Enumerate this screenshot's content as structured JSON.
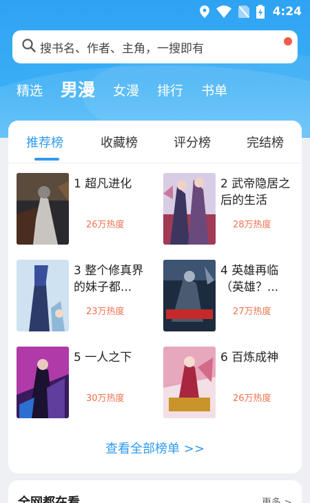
{
  "status_bar": {
    "time": "4:24"
  },
  "search": {
    "placeholder": "搜书名、作者、主角，一搜即有"
  },
  "top_tabs": [
    {
      "label": "精选",
      "active": false
    },
    {
      "label": "男漫",
      "active": true
    },
    {
      "label": "女漫",
      "active": false
    },
    {
      "label": "排行",
      "active": false
    },
    {
      "label": "书单",
      "active": false
    }
  ],
  "rank_tabs": [
    {
      "label": "推荐榜",
      "active": true
    },
    {
      "label": "收藏榜",
      "active": false
    },
    {
      "label": "评分榜",
      "active": false
    },
    {
      "label": "完结榜",
      "active": false
    }
  ],
  "books": [
    {
      "rank": "1",
      "title": "超凡进化",
      "heat": "26万热度"
    },
    {
      "rank": "2",
      "title": "武帝隐居之后的生活",
      "heat": "28万热度"
    },
    {
      "rank": "3",
      "title": "整个修真界的妹子都...",
      "heat": "23万热度"
    },
    {
      "rank": "4",
      "title": "英雄再临（英雄？...",
      "heat": "27万热度"
    },
    {
      "rank": "5",
      "title": "一人之下",
      "heat": "30万热度"
    },
    {
      "rank": "6",
      "title": "百炼成神",
      "heat": "26万热度"
    }
  ],
  "see_all": "查看全部榜单 >>",
  "section2": {
    "title": "全网都在看",
    "more": "更多 >"
  },
  "colors": {
    "accent": "#2f9bef",
    "header": "#34a8f4",
    "heat": "#f0714d"
  }
}
